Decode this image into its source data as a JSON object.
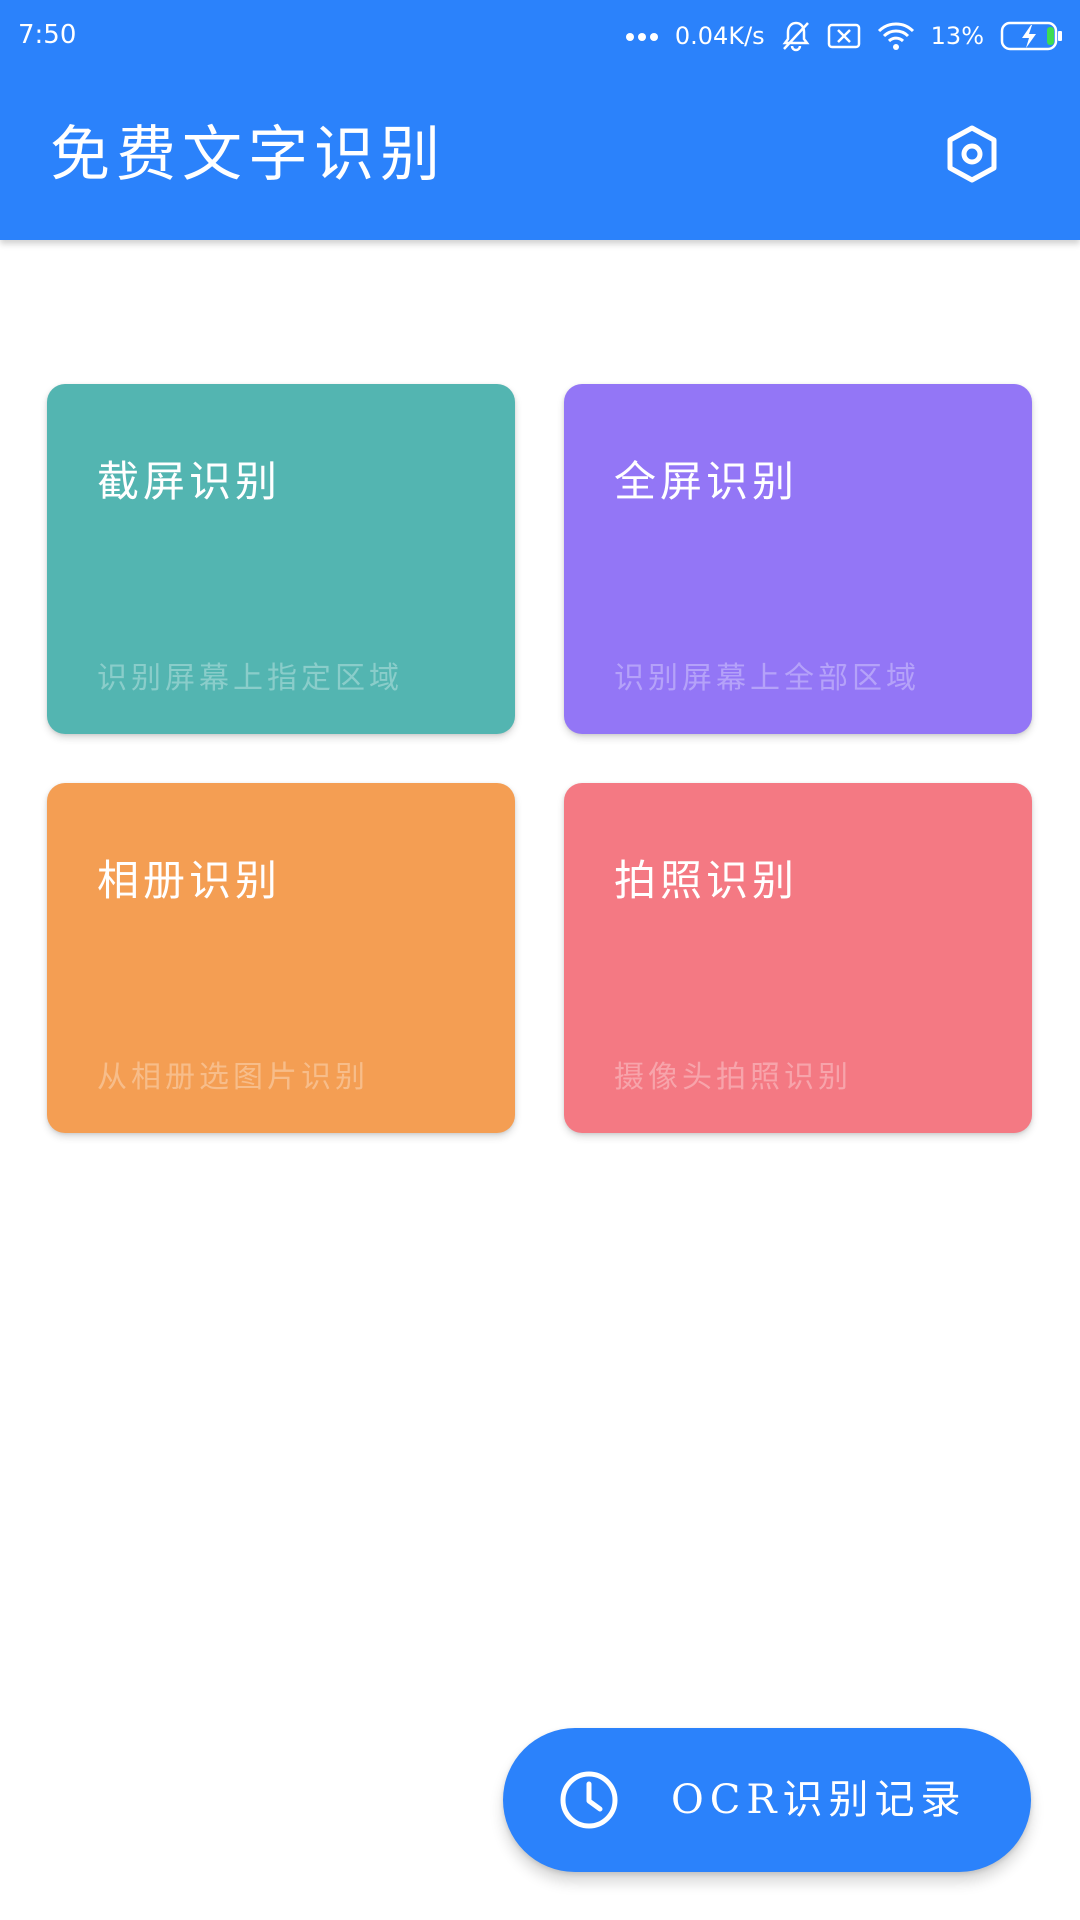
{
  "status_bar": {
    "time": "7:50",
    "network_speed": "0.04K/s",
    "battery_percent": "13%",
    "icons": [
      "more-dots-icon",
      "bell-off-icon",
      "sim-off-icon",
      "wifi-icon",
      "battery-charging-icon"
    ]
  },
  "header": {
    "title": "免费文字识别",
    "settings_icon": "settings-hexagon-icon",
    "background_color": "#2b82fb"
  },
  "cards": [
    {
      "title": "截屏识别",
      "description": "识别屏幕上指定区域",
      "color": "#53b5b1"
    },
    {
      "title": "全屏识别",
      "description": "识别屏幕上全部区域",
      "color": "#9376f6"
    },
    {
      "title": "相册识别",
      "description": "从相册选图片识别",
      "color": "#f49e53"
    },
    {
      "title": "拍照识别",
      "description": "摄像头拍照识别",
      "color": "#f47983"
    }
  ],
  "fab": {
    "label": "OCR识别记录",
    "icon": "clock-icon",
    "color": "#2b82fb"
  }
}
